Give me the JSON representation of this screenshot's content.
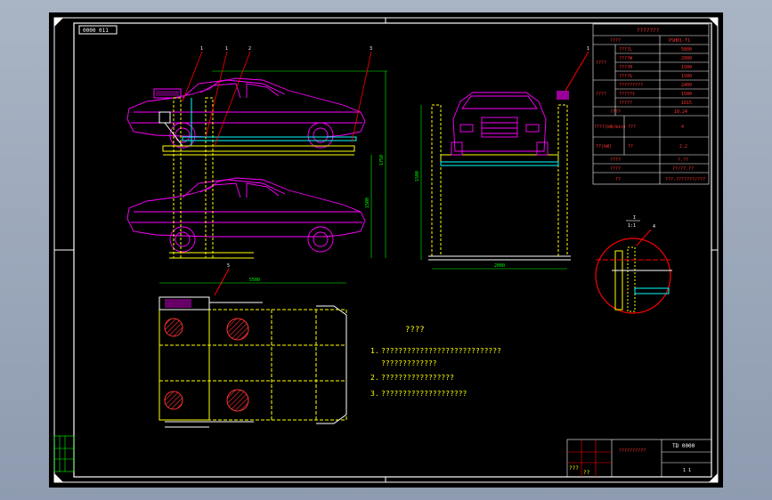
{
  "title_tag": "0000 011",
  "spec_table": {
    "title": "???????",
    "model_header": "????",
    "model_value": "PSH01-T1",
    "size_group": "????",
    "size_rows": [
      {
        "label": "????L",
        "value": "5000"
      },
      {
        "label": "????W",
        "value": "2000"
      },
      {
        "label": "????H",
        "value": "1500"
      },
      {
        "label": "????G",
        "value": "1500"
      }
    ],
    "weight_group": "????",
    "weight_rows": [
      {
        "label": "?????????",
        "value": "2400"
      },
      {
        "label": "?????t",
        "value": "1500"
      },
      {
        "label": "?????",
        "value": "1615"
      }
    ],
    "misc_rows": [
      {
        "label": "????",
        "value": "10.24"
      },
      {
        "label": "????(kW/min)",
        "sub": "???",
        "value": "4"
      },
      {
        "label": "??(kW)",
        "sub": "??",
        "value": "2.2"
      },
      {
        "label": "????",
        "value": "?.??"
      },
      {
        "label": "????",
        "value": "??/??.??"
      },
      {
        "label": "??",
        "value": "???.???????/???"
      }
    ]
  },
  "callouts": {
    "c1": "1",
    "c2": "1",
    "c3": "2",
    "c4": "3",
    "c5": "1",
    "c6": "4",
    "c7": "5"
  },
  "dims": {
    "front_height": "1750",
    "front_height2": "1500",
    "side_width": "2000",
    "side_height": "1500",
    "side_bottom": "2950",
    "plan_width": "5500",
    "detail_label": "I",
    "detail_scale": "1:1"
  },
  "notes": {
    "heading": "????",
    "lines": [
      {
        "num": "1.",
        "text": "????????????????????????????"
      },
      {
        "num": "",
        "text": "?????????????"
      },
      {
        "num": "2.",
        "text": "?????????????????"
      },
      {
        "num": "3.",
        "text": "????????????????????"
      }
    ]
  },
  "title_block": {
    "drawing_name": "??????????",
    "drawing_no": "TD 0000",
    "row_a": "???",
    "row_b": "??",
    "sheet": "1  1"
  },
  "colors": {
    "frame": "#ffffff",
    "car": "#ff00ff",
    "structure": "#ffff00",
    "platform": "#00ffff",
    "annotation": "#00ff00",
    "leader": "#ff0000"
  }
}
